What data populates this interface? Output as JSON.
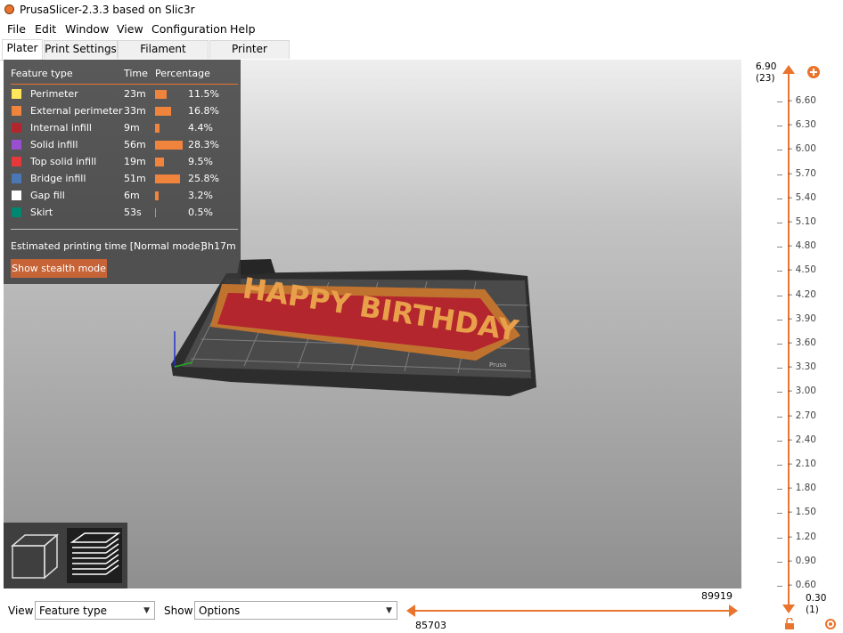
{
  "window": {
    "title": "PrusaSlicer-2.3.3 based on Slic3r"
  },
  "menu": [
    "File",
    "Edit",
    "Window",
    "View",
    "Configuration",
    "Help"
  ],
  "tabs": [
    "Plater",
    "Print Settings",
    "Filament Settings",
    "Printer Settings"
  ],
  "legend": {
    "headers": {
      "feature": "Feature type",
      "time": "Time",
      "percentage": "Percentage"
    },
    "rows": [
      {
        "name": "Perimeter",
        "time": "23m",
        "percent": "11.5%",
        "value": 11.5,
        "color": "#ffe65a"
      },
      {
        "name": "External perimeter",
        "time": "33m",
        "percent": "16.8%",
        "value": 16.8,
        "color": "#f0843c"
      },
      {
        "name": "Internal infill",
        "time": "9m",
        "percent": "4.4%",
        "value": 4.4,
        "color": "#b3262e"
      },
      {
        "name": "Solid infill",
        "time": "56m",
        "percent": "28.3%",
        "value": 28.3,
        "color": "#9a4fd0"
      },
      {
        "name": "Top solid infill",
        "time": "19m",
        "percent": "9.5%",
        "value": 9.5,
        "color": "#e5383b"
      },
      {
        "name": "Bridge infill",
        "time": "51m",
        "percent": "25.8%",
        "value": 25.8,
        "color": "#4a78b6"
      },
      {
        "name": "Gap fill",
        "time": "6m",
        "percent": "3.2%",
        "value": 3.2,
        "color": "#ffffff"
      },
      {
        "name": "Skirt",
        "time": "53s",
        "percent": "0.5%",
        "value": 0.5,
        "color": "#00876f"
      }
    ],
    "estimate_label": "Estimated printing time [Normal mode]:",
    "estimate_value": "3h17m",
    "stealth_button": "Show stealth mode"
  },
  "model": {
    "bed_logo": "Prusa"
  },
  "vertical_slider": {
    "top_value": "6.90",
    "top_layer": "(23)",
    "bottom_value": "0.30",
    "bottom_layer": "(1)",
    "ticks": [
      "6.60",
      "6.30",
      "6.00",
      "5.70",
      "5.40",
      "5.10",
      "4.80",
      "4.50",
      "4.20",
      "3.90",
      "3.60",
      "3.30",
      "3.00",
      "2.70",
      "2.40",
      "2.10",
      "1.80",
      "1.50",
      "1.20",
      "0.90",
      "0.60"
    ]
  },
  "horizontal_slider": {
    "top_value": "89919",
    "bottom_value": "85703"
  },
  "bottom_bar": {
    "view_label": "View",
    "view_value": "Feature type",
    "show_label": "Show",
    "show_value": "Options"
  }
}
